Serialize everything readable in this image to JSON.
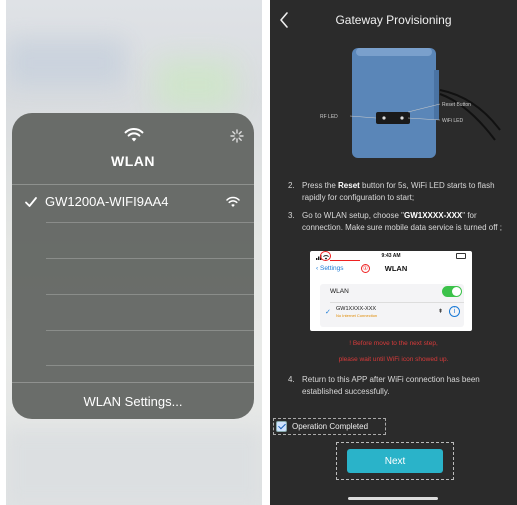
{
  "left": {
    "wlan_title": "WLAN",
    "networks": [
      {
        "name": "GW1200A-WIFI9AA4",
        "selected": true
      }
    ],
    "settings_label": "WLAN Settings..."
  },
  "right": {
    "nav_title": "Gateway Provisioning",
    "device_labels": {
      "reset_button": "Reset Button",
      "rf_led": "RF LED",
      "wifi_led": "WiFi LED"
    },
    "step2": {
      "num": "2.",
      "pre": "Press the ",
      "bold": "Reset",
      "post": " button for 5s, WiFi LED starts to flash rapidly for configuration to start;"
    },
    "step3": {
      "num": "3.",
      "pre": "Go to WLAN setup, choose \"",
      "bold": "GW1XXXX-XXX",
      "post": "\" for connection. Make sure mobile data service is turned off ;"
    },
    "phone": {
      "time": "9:43 AM",
      "back_label": "Settings",
      "title": "WLAN",
      "badge": "①",
      "wlan_label": "WLAN",
      "network": "GW1XXXX-XXX",
      "no_internet": "No Internet Connection"
    },
    "warning_line1": "! Before move to the next step,",
    "warning_line2": "please wait until WiFi icon showed up.",
    "step4": {
      "num": "4.",
      "text": "Return to this APP after WiFi connection has been established successfully."
    },
    "operation_completed": "Operation Completed",
    "next_label": "Next",
    "colors": {
      "accent": "#2ab3c9",
      "toggle": "#3cc24a",
      "warning": "#d83a3a"
    }
  }
}
